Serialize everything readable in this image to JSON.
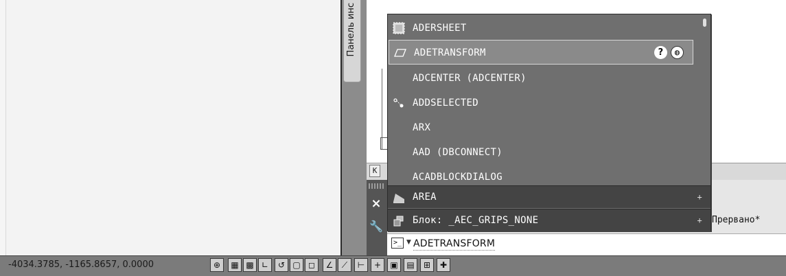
{
  "palette": {
    "tab_label": "Панель инс"
  },
  "autocomplete": {
    "items": [
      {
        "label": "ADERSHEET",
        "icon": "sheet-icon",
        "kind": "command"
      },
      {
        "label": "ADETRANSFORM",
        "icon": "parallelogram-icon",
        "kind": "command",
        "selected": true
      },
      {
        "label": "ADCENTER (ADCENTER)",
        "icon": "",
        "kind": "command"
      },
      {
        "label": "ADDSELECTED",
        "icon": "add-selected-icon",
        "kind": "command"
      },
      {
        "label": "ARX",
        "icon": "",
        "kind": "command"
      },
      {
        "label": "AAD (DBCONNECT)",
        "icon": "",
        "kind": "command"
      },
      {
        "label": "ACADBLOCKDIALOG",
        "icon": "",
        "kind": "command"
      },
      {
        "label": "AREA",
        "icon": "area-icon",
        "kind": "group",
        "expand": "+"
      },
      {
        "label": "Блок: _AEC_GRIPS_NONE",
        "icon": "block-icon",
        "kind": "group",
        "expand": "+"
      }
    ],
    "help_label": "?",
    "globe_label": "◍"
  },
  "layout_nav": {
    "first_label": "K"
  },
  "command_line": {
    "prompt_icon": ">_",
    "prompt_caret": "▼",
    "input_value": "ADETRANSFORM",
    "history_text": "Прервано*"
  },
  "side_tools": {
    "close": "×",
    "wrench": "🔧"
  },
  "status": {
    "coordinates": "-4034.3785, -1165.8657, 0.0000",
    "buttons": [
      "⊕",
      "▦",
      "▩",
      "∟",
      "↺",
      "▢",
      "◻",
      "∠",
      "⟋",
      "⊢",
      "+",
      "▣",
      "▤",
      "⊞",
      "✚"
    ]
  }
}
